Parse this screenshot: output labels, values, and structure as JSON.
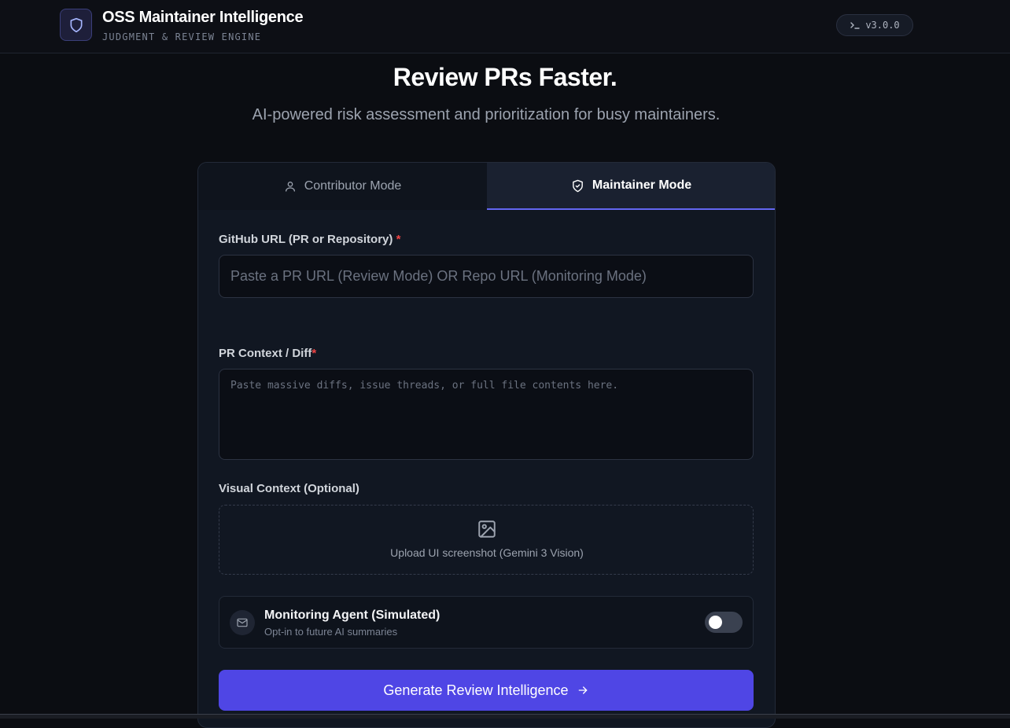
{
  "header": {
    "title": "OSS Maintainer Intelligence",
    "subtitle": "JUDGMENT & REVIEW ENGINE",
    "logo_icon": "shield-icon",
    "version": "v3.0.0",
    "version_icon": "terminal-prompt-icon"
  },
  "hero": {
    "title": "Review PRs Faster.",
    "subtitle": "AI-powered risk assessment and prioritization for busy maintainers."
  },
  "tabs": [
    {
      "label": "Contributor Mode",
      "icon": "user-icon",
      "active": false
    },
    {
      "label": "Maintainer Mode",
      "icon": "shield-check-icon",
      "active": true
    }
  ],
  "form": {
    "url_label": "GitHub URL (PR or Repository)",
    "url_required": "*",
    "url_placeholder": "Paste a PR URL (Review Mode) OR Repo URL (Monitoring Mode)",
    "url_value": "",
    "diff_label": "PR Context / Diff",
    "diff_required": "*",
    "diff_placeholder": "Paste massive diffs, issue threads, or full file contents here.",
    "diff_value": "",
    "visual_label": "Visual Context (Optional)",
    "upload_icon": "image-icon",
    "upload_text": "Upload UI screenshot (Gemini 3 Vision)",
    "monitor_icon": "mail-icon",
    "monitor_title": "Monitoring Agent (Simulated)",
    "monitor_subtitle": "Opt-in to future AI summaries",
    "monitor_enabled": false,
    "submit_label": "Generate Review Intelligence",
    "submit_icon": "arrow-right-icon"
  },
  "colors": {
    "background": "#0b0d12",
    "card": "#111722",
    "accent": "#4f46e5",
    "active_tab_underline": "#6366f1",
    "required": "#ef4444"
  }
}
